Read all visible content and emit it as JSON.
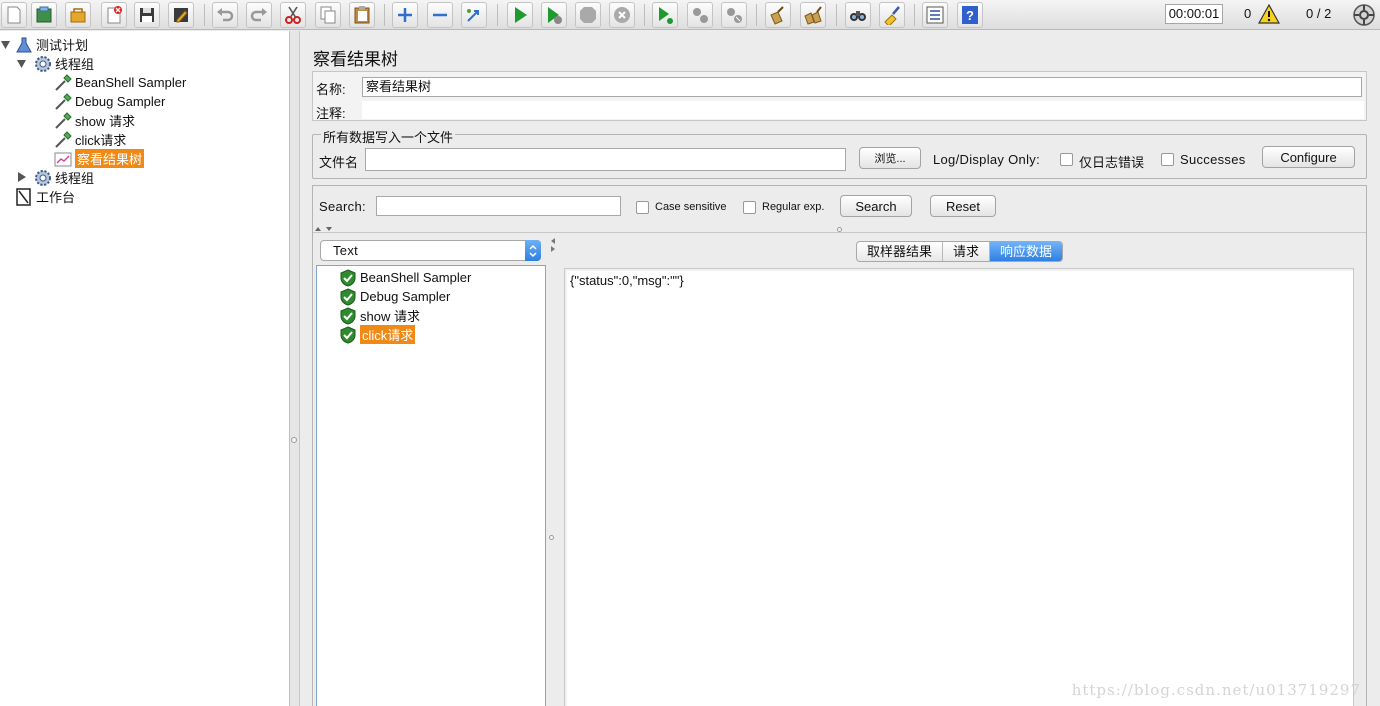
{
  "toolbar": {
    "buttons": [
      "new-icon",
      "templates-icon",
      "open-icon",
      "close-icon",
      "save-icon",
      "save-as-icon",
      "undo-icon",
      "redo-icon",
      "cut-icon",
      "copy-icon",
      "paste-icon",
      "expand-icon",
      "collapse-icon",
      "toggle-icon",
      "start-icon",
      "start-no-pause-icon",
      "stop-icon",
      "shutdown-icon",
      "remote-start-icon",
      "remote-stop-icon",
      "remote-shutdown-icon",
      "clear-icon",
      "clear-all-icon",
      "search-icon",
      "reset-search-icon",
      "function-helper-icon",
      "help-icon"
    ],
    "timer": "00:00:01",
    "error_count": "0",
    "threads": "0 / 2"
  },
  "tree": {
    "test_plan": "测试计划",
    "thread_group_1": "线程组",
    "items": [
      "BeanShell Sampler",
      "Debug Sampler",
      "show 请求",
      "click请求"
    ],
    "selected": "察看结果树",
    "thread_group_2": "线程组",
    "workbench": "工作台"
  },
  "panel": {
    "title": "察看结果树",
    "name_label": "名称:",
    "name_value": "察看结果树",
    "comment_label": "注释:",
    "file_section_title": "所有数据写入一个文件",
    "filename_label": "文件名",
    "browse_label": "浏览...",
    "log_display_label": "Log/Display Only:",
    "errors_label": "仅日志错误",
    "successes_label": "Successes",
    "configure_label": "Configure"
  },
  "search": {
    "label": "Search:",
    "case_sensitive_label": "Case sensitive",
    "regex_label": "Regular exp.",
    "search_button": "Search",
    "reset_button": "Reset"
  },
  "results": {
    "view_mode": "Text",
    "samples": [
      "BeanShell Sampler",
      "Debug Sampler",
      "show 请求",
      "click请求"
    ],
    "selected_sample": "click请求",
    "tabs": [
      "取样器结果",
      "请求",
      "响应数据"
    ],
    "active_tab": "响应数据",
    "response_text": "{\"status\":0,\"msg\":\"\"}",
    "watermark": "https://blog.csdn.net/u013719297"
  },
  "colors": {
    "selection": "#f08a17",
    "tab_active": "#2f80e2",
    "success_shield": "#2e8b2e"
  }
}
